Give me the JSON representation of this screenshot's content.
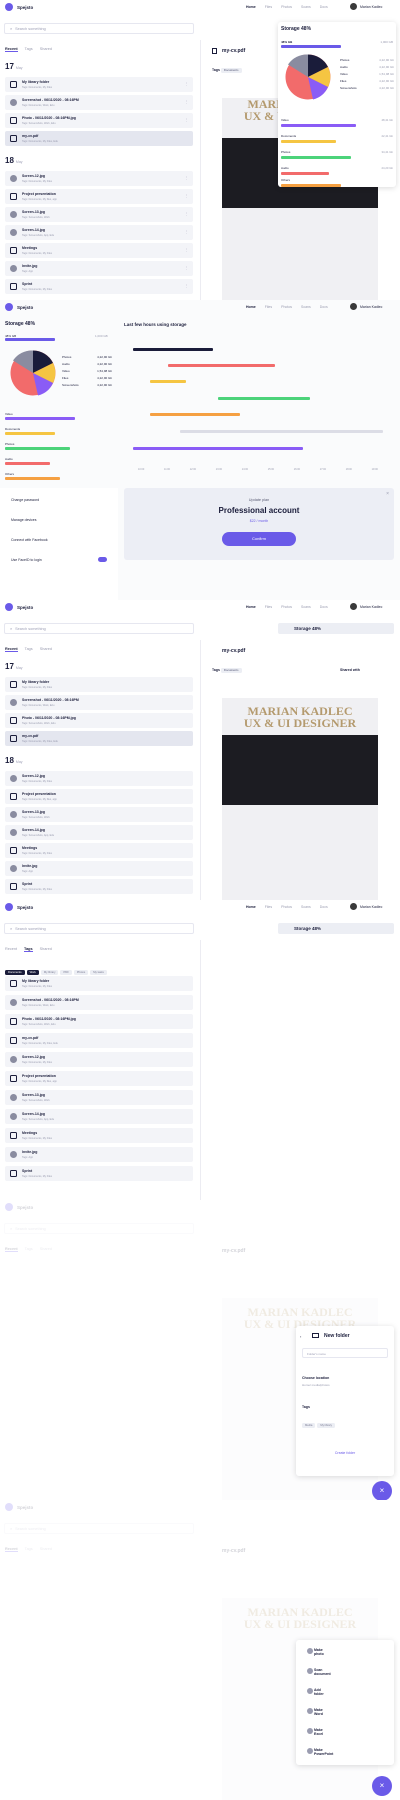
{
  "app": {
    "brand": "Spejsto",
    "nav": [
      "Home",
      "Files",
      "Photos",
      "Scans",
      "Docs"
    ],
    "user": "Marian Kadlec",
    "search_placeholder": "Search something",
    "tabs": [
      "Recent",
      "Tags",
      "Shared"
    ]
  },
  "day17": {
    "n": "17",
    "m": "May"
  },
  "day18": {
    "n": "18",
    "m": "May"
  },
  "files17": [
    {
      "t": "My library folder",
      "s": "Tags: Documents, My Files"
    },
    {
      "t": "Screenshot - 06/11/2020 - 08:16PM",
      "s": "Tags: Documents, Work, Edu"
    },
    {
      "t": "Photo - 06/11/2020 - 08:16PM.jpg",
      "s": "Tags: Screenshots, Work, Edu"
    },
    {
      "t": "my-cv.pdf",
      "s": "Tags: Documents, My Files, Edu"
    }
  ],
  "files18": [
    {
      "t": "Screen-12.jpg",
      "s": "Tags: Documents, My Files"
    },
    {
      "t": "Project presentation",
      "s": "Tags: Documents, My files, app"
    },
    {
      "t": "Screen-13.jpg",
      "s": "Tags: Screenshots, Work"
    },
    {
      "t": "Screen-14.jpg",
      "s": "Tags: Screenshots, App, Edu"
    },
    {
      "t": "Meetings",
      "s": "Tags: Documents, My Files"
    },
    {
      "t": "Invite.jpg",
      "s": "Tags: App"
    },
    {
      "t": "Sprint",
      "s": "Tags: Documents, My Files"
    }
  ],
  "preview": {
    "title": "my-cv.pdf",
    "tags_label": "Tags",
    "tag": "Documents",
    "shared": "Shared with",
    "cv1": "MARIAN KADLEC",
    "cv2": "UX & UI DESIGNER"
  },
  "storage": {
    "title": "Storage 48%",
    "used": "48% GB",
    "total": "1,000 GB",
    "legend": [
      {
        "n": "Photos",
        "v": "4,22,90 Gb",
        "c": "#f26b6b"
      },
      {
        "n": "Audio",
        "v": "4,22,90 Gb",
        "c": "#1a1c3a"
      },
      {
        "n": "Video",
        "v": "1,54,98 Gb",
        "c": "#3b5bdb"
      },
      {
        "n": "Files",
        "v": "4,22,90 Gb",
        "c": "#f5c542"
      },
      {
        "n": "Screenshots",
        "v": "4,22,90 Gb",
        "c": "#8a5cf6"
      }
    ],
    "rows": [
      {
        "n": "Video",
        "v": "48,41 Gb",
        "c": "#8a5cf6",
        "p": 0.7
      },
      {
        "n": "Documents",
        "v": "22,41 Gb",
        "c": "#f5c542",
        "p": 0.5
      },
      {
        "n": "Photos",
        "v": "34,41 Gb",
        "c": "#4cd37a",
        "p": 0.65
      },
      {
        "n": "Audio",
        "v": "24,20 Gb",
        "c": "#f26b6b",
        "p": 0.45
      },
      {
        "n": "Others",
        "v": "3,01 Gb",
        "c": "#f5a042",
        "p": 0.55
      }
    ]
  },
  "chart": {
    "title": "Last few hours using storage",
    "ticks": [
      "10:00",
      "11:00",
      "12:00",
      "13:00",
      "14:00",
      "15:00",
      "16:00",
      "17:00",
      "18:00",
      "19:00"
    ]
  },
  "settings": [
    "Change password",
    "Manage devices",
    "Connect with Facebook",
    "Use FaceID to login"
  ],
  "plan": {
    "kicker": "Update plan",
    "title": "Professional account",
    "price": "$22 / month",
    "btn": "Confirm"
  },
  "tagfilters": [
    "Documents",
    "Work",
    "My library",
    "PDF",
    "Photos",
    "My tasks"
  ],
  "folder": {
    "title": "New folder",
    "placeholder": "Folder's name",
    "loc_label": "Choose location",
    "loc_val": "Home/ media/photos",
    "tags_label": "Tags",
    "t1": "Media",
    "t2": "My library",
    "create": "Create folder"
  },
  "fabmenu": [
    "Make photo",
    "Scan document",
    "Add folder",
    "Make Word",
    "Make Excel",
    "Make PowerPoint"
  ]
}
